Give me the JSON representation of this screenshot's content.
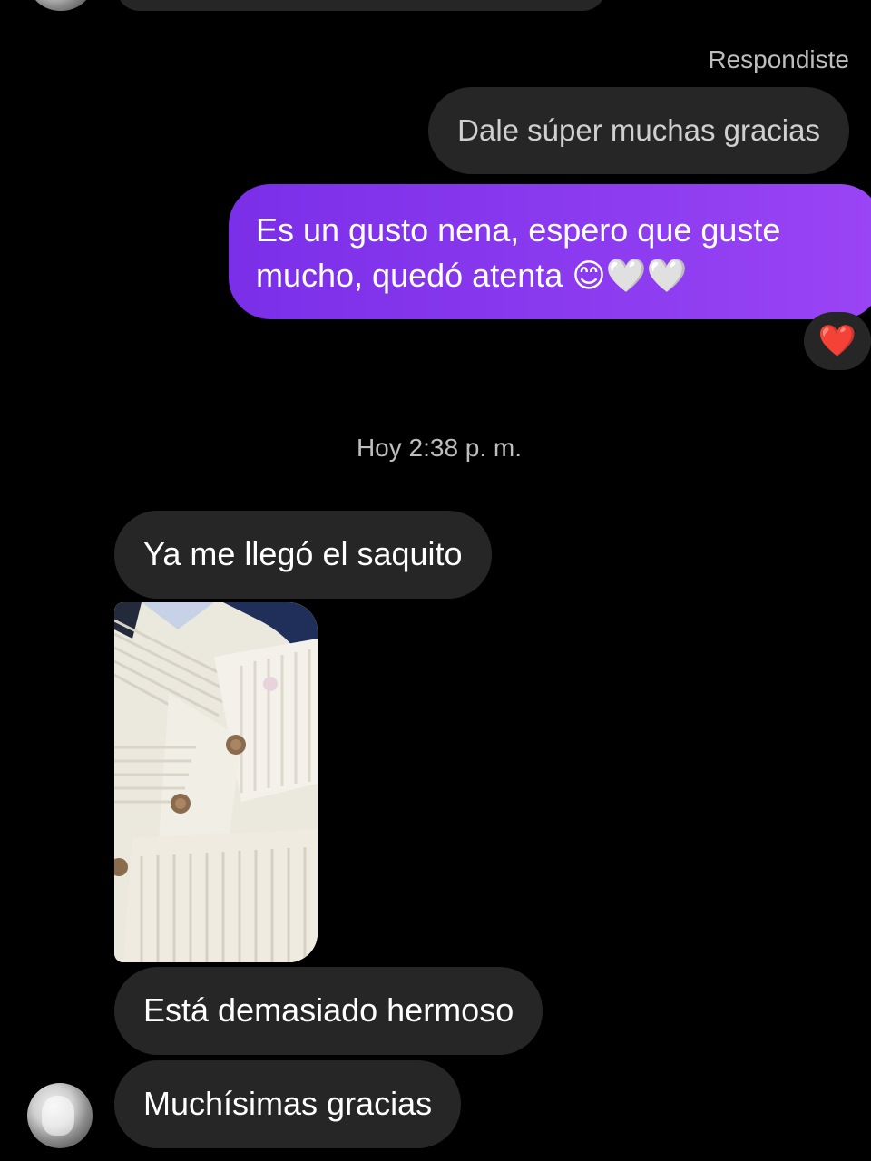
{
  "thread": {
    "reply_label": "Respondiste",
    "replied_message": "Dale súper muchas gracias",
    "sent_message": {
      "line1": "Es un gusto nena, espero que guste",
      "line2": "mucho, quedó atenta 😊🤍🤍"
    },
    "reaction": "❤️",
    "timestamp": "Hoy 2:38 p. m.",
    "received_messages": [
      "Ya me llegó el saquito",
      "Está demasiado hermoso",
      "Muchísimas gracias"
    ]
  },
  "colors": {
    "background": "#000000",
    "received_bubble": "#262626",
    "sent_bubble_start": "#7a2fe8",
    "sent_bubble_end": "#9a44f5",
    "muted_text": "#bdbdbd",
    "reaction": "#e8232f"
  },
  "icons": {
    "reaction": "heart-icon",
    "avatar": "contact-avatar"
  }
}
